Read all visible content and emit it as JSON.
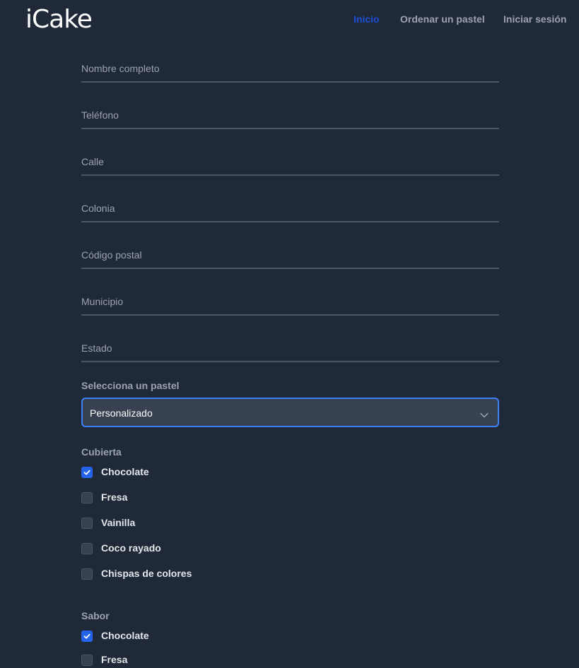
{
  "brand": {
    "logo_text": "iCake"
  },
  "nav": {
    "items": [
      {
        "label": "Inicio"
      },
      {
        "label": "Ordenar un pastel"
      },
      {
        "label": "Iniciar sesión"
      }
    ],
    "active_index": 0
  },
  "form": {
    "fields": [
      {
        "label": "Nombre completo",
        "value": ""
      },
      {
        "label": "Teléfono",
        "value": ""
      },
      {
        "label": "Calle",
        "value": ""
      },
      {
        "label": "Colonia",
        "value": ""
      },
      {
        "label": "Código postal",
        "value": ""
      },
      {
        "label": "Municipio",
        "value": ""
      },
      {
        "label": "Estado",
        "value": ""
      }
    ],
    "cake_select": {
      "label": "Selecciona un pastel",
      "selected": "Personalizado"
    },
    "cubierta": {
      "title": "Cubierta",
      "options": [
        {
          "label": "Chocolate",
          "checked": true
        },
        {
          "label": "Fresa",
          "checked": false
        },
        {
          "label": "Vainilla",
          "checked": false
        },
        {
          "label": "Coco rayado",
          "checked": false
        },
        {
          "label": "Chispas de colores",
          "checked": false
        }
      ]
    },
    "sabor": {
      "title": "Sabor",
      "options": [
        {
          "label": "Chocolate",
          "checked": true
        },
        {
          "label": "Fresa",
          "checked": false
        }
      ]
    }
  },
  "colors": {
    "background": "#1f2937",
    "accent": "#2563eb",
    "nav_active": "#1d4ed8",
    "muted_text": "#9ca3af"
  }
}
